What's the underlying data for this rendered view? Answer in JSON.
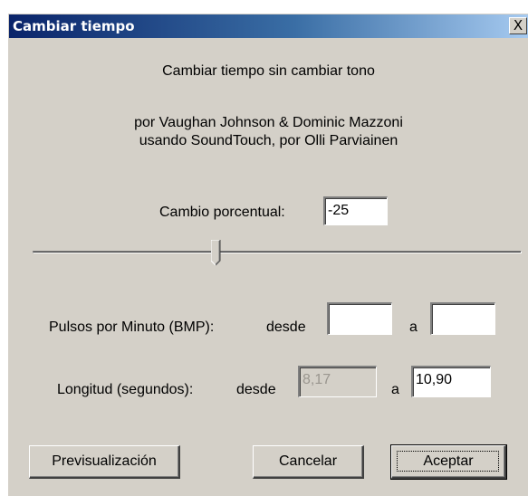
{
  "window": {
    "title": "Cambiar tiempo",
    "close_glyph": "X"
  },
  "header": {
    "line1": "Cambiar tiempo sin cambiar tono",
    "line2": "por Vaughan Johnson & Dominic Mazzoni",
    "line3": "usando SoundTouch, por Olli Parviainen"
  },
  "percent_change": {
    "label": "Cambio porcentual:",
    "value": "-25"
  },
  "slider": {
    "value": -25
  },
  "bpm": {
    "label": "Pulsos por Minuto (BMP):",
    "from_label": "desde",
    "from_value": "",
    "to_label": "a",
    "to_value": ""
  },
  "length": {
    "label": "Longitud (segundos):",
    "from_label": "desde",
    "from_value": "8,17",
    "to_label": "a",
    "to_value": "10,90"
  },
  "buttons": {
    "preview": "Previsualización",
    "cancel": "Cancelar",
    "ok": "Aceptar"
  }
}
